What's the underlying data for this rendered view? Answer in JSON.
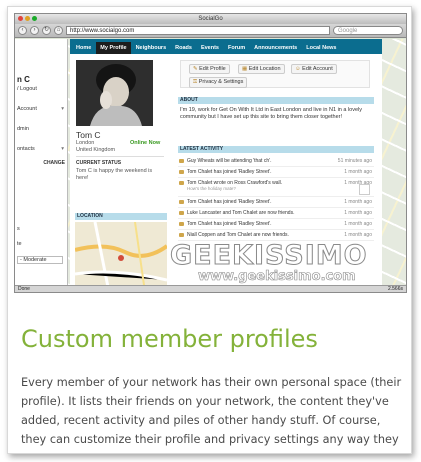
{
  "browser": {
    "window_title": "SocialGo",
    "url": "http://www.socialgo.com",
    "search_placeholder": "Google",
    "status_left": "Done",
    "status_right": "2.566s"
  },
  "left_panel": {
    "name_fragment": "n C",
    "logout": "/ Logout",
    "account": "Account",
    "admin": "dmin",
    "contacts": "ontacts",
    "change": "CHANGE",
    "s_item": "s",
    "te_item": "te",
    "moderate": "- Moderate"
  },
  "nav": {
    "tabs": [
      "Home",
      "My Profile",
      "Neighbours",
      "Roads",
      "Events",
      "Forum",
      "Announcements",
      "Local News"
    ],
    "active_index": 1
  },
  "profile": {
    "name": "Tom C",
    "city": "London",
    "country": "United Kingdom",
    "online": "Online Now",
    "status_title": "CURRENT STATUS",
    "status_line1": "Tom C is happy the weekend is",
    "status_line2": "here!",
    "location_title": "LOCATION"
  },
  "actions": {
    "edit_profile": "Edit Profile",
    "edit_location": "Edit Location",
    "edit_account": "Edit Account",
    "privacy_settings": "Privacy & Settings"
  },
  "about": {
    "title": "ABOUT",
    "text": "I'm 19, work for Get On With It Ltd in East London and live in N1 in a lovely community but I have set up this site to bring them closer together!"
  },
  "activity": {
    "title": "LATEST ACTIVITY",
    "items": [
      {
        "text": "Guy Wheats will be attending 'that ch'.",
        "time": "51 minutes ago",
        "sub": ""
      },
      {
        "text": "Tom Chalet has joined 'Radley Street'.",
        "time": "1 month ago",
        "sub": ""
      },
      {
        "text": "Tom Chalet wrote on Ross Crawford's wall.",
        "time": "1 month ago",
        "sub": "How's the holiday mate?"
      },
      {
        "text": "Tom Chalet has joined 'Radley Street'.",
        "time": "1 month ago",
        "sub": ""
      },
      {
        "text": "Luke Lancaster and Tom Chalet are now friends.",
        "time": "1 month ago",
        "sub": ""
      },
      {
        "text": "Tom Chalet has joined 'Radley Street'.",
        "time": "1 month ago",
        "sub": ""
      },
      {
        "text": "Niall Coppen and Tom Chalet are now friends.",
        "time": "1 month ago",
        "sub": ""
      }
    ]
  },
  "watermark": {
    "brand": "GEEKISSIMO",
    "site": "www.geekissimo.com"
  },
  "article": {
    "heading": "Custom member profiles",
    "body": "Every member of your network has their own personal space (their profile). It lists their friends on your network, the content they've added, recent activity and piles of other handy stuff. Of course, they can customize their profile and privacy settings any way they want."
  },
  "colors": {
    "nav_bar": "#0b6d8f",
    "section_header": "#b7dcea",
    "heading_green": "#84b23a",
    "online_green": "#3a9a21"
  }
}
